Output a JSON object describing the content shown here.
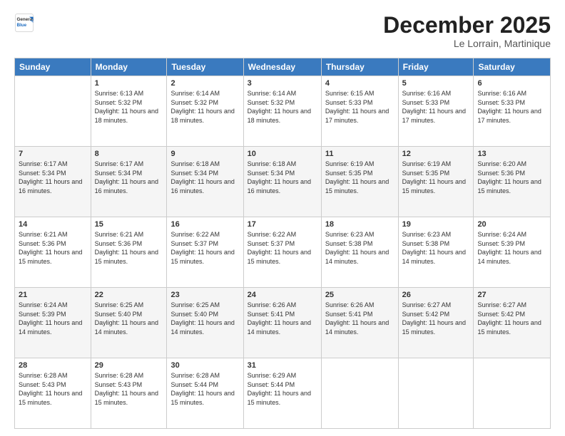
{
  "logo": {
    "general": "General",
    "blue": "Blue"
  },
  "header": {
    "month": "December 2025",
    "location": "Le Lorrain, Martinique"
  },
  "weekdays": [
    "Sunday",
    "Monday",
    "Tuesday",
    "Wednesday",
    "Thursday",
    "Friday",
    "Saturday"
  ],
  "weeks": [
    [
      {
        "day": "",
        "sunrise": "",
        "sunset": "",
        "daylight": ""
      },
      {
        "day": "1",
        "sunrise": "6:13 AM",
        "sunset": "5:32 PM",
        "daylight": "11 hours and 18 minutes."
      },
      {
        "day": "2",
        "sunrise": "6:14 AM",
        "sunset": "5:32 PM",
        "daylight": "11 hours and 18 minutes."
      },
      {
        "day": "3",
        "sunrise": "6:14 AM",
        "sunset": "5:32 PM",
        "daylight": "11 hours and 18 minutes."
      },
      {
        "day": "4",
        "sunrise": "6:15 AM",
        "sunset": "5:33 PM",
        "daylight": "11 hours and 17 minutes."
      },
      {
        "day": "5",
        "sunrise": "6:16 AM",
        "sunset": "5:33 PM",
        "daylight": "11 hours and 17 minutes."
      },
      {
        "day": "6",
        "sunrise": "6:16 AM",
        "sunset": "5:33 PM",
        "daylight": "11 hours and 17 minutes."
      }
    ],
    [
      {
        "day": "7",
        "sunrise": "6:17 AM",
        "sunset": "5:34 PM",
        "daylight": "11 hours and 16 minutes."
      },
      {
        "day": "8",
        "sunrise": "6:17 AM",
        "sunset": "5:34 PM",
        "daylight": "11 hours and 16 minutes."
      },
      {
        "day": "9",
        "sunrise": "6:18 AM",
        "sunset": "5:34 PM",
        "daylight": "11 hours and 16 minutes."
      },
      {
        "day": "10",
        "sunrise": "6:18 AM",
        "sunset": "5:34 PM",
        "daylight": "11 hours and 16 minutes."
      },
      {
        "day": "11",
        "sunrise": "6:19 AM",
        "sunset": "5:35 PM",
        "daylight": "11 hours and 15 minutes."
      },
      {
        "day": "12",
        "sunrise": "6:19 AM",
        "sunset": "5:35 PM",
        "daylight": "11 hours and 15 minutes."
      },
      {
        "day": "13",
        "sunrise": "6:20 AM",
        "sunset": "5:36 PM",
        "daylight": "11 hours and 15 minutes."
      }
    ],
    [
      {
        "day": "14",
        "sunrise": "6:21 AM",
        "sunset": "5:36 PM",
        "daylight": "11 hours and 15 minutes."
      },
      {
        "day": "15",
        "sunrise": "6:21 AM",
        "sunset": "5:36 PM",
        "daylight": "11 hours and 15 minutes."
      },
      {
        "day": "16",
        "sunrise": "6:22 AM",
        "sunset": "5:37 PM",
        "daylight": "11 hours and 15 minutes."
      },
      {
        "day": "17",
        "sunrise": "6:22 AM",
        "sunset": "5:37 PM",
        "daylight": "11 hours and 15 minutes."
      },
      {
        "day": "18",
        "sunrise": "6:23 AM",
        "sunset": "5:38 PM",
        "daylight": "11 hours and 14 minutes."
      },
      {
        "day": "19",
        "sunrise": "6:23 AM",
        "sunset": "5:38 PM",
        "daylight": "11 hours and 14 minutes."
      },
      {
        "day": "20",
        "sunrise": "6:24 AM",
        "sunset": "5:39 PM",
        "daylight": "11 hours and 14 minutes."
      }
    ],
    [
      {
        "day": "21",
        "sunrise": "6:24 AM",
        "sunset": "5:39 PM",
        "daylight": "11 hours and 14 minutes."
      },
      {
        "day": "22",
        "sunrise": "6:25 AM",
        "sunset": "5:40 PM",
        "daylight": "11 hours and 14 minutes."
      },
      {
        "day": "23",
        "sunrise": "6:25 AM",
        "sunset": "5:40 PM",
        "daylight": "11 hours and 14 minutes."
      },
      {
        "day": "24",
        "sunrise": "6:26 AM",
        "sunset": "5:41 PM",
        "daylight": "11 hours and 14 minutes."
      },
      {
        "day": "25",
        "sunrise": "6:26 AM",
        "sunset": "5:41 PM",
        "daylight": "11 hours and 14 minutes."
      },
      {
        "day": "26",
        "sunrise": "6:27 AM",
        "sunset": "5:42 PM",
        "daylight": "11 hours and 15 minutes."
      },
      {
        "day": "27",
        "sunrise": "6:27 AM",
        "sunset": "5:42 PM",
        "daylight": "11 hours and 15 minutes."
      }
    ],
    [
      {
        "day": "28",
        "sunrise": "6:28 AM",
        "sunset": "5:43 PM",
        "daylight": "11 hours and 15 minutes."
      },
      {
        "day": "29",
        "sunrise": "6:28 AM",
        "sunset": "5:43 PM",
        "daylight": "11 hours and 15 minutes."
      },
      {
        "day": "30",
        "sunrise": "6:28 AM",
        "sunset": "5:44 PM",
        "daylight": "11 hours and 15 minutes."
      },
      {
        "day": "31",
        "sunrise": "6:29 AM",
        "sunset": "5:44 PM",
        "daylight": "11 hours and 15 minutes."
      },
      {
        "day": "",
        "sunrise": "",
        "sunset": "",
        "daylight": ""
      },
      {
        "day": "",
        "sunrise": "",
        "sunset": "",
        "daylight": ""
      },
      {
        "day": "",
        "sunrise": "",
        "sunset": "",
        "daylight": ""
      }
    ]
  ],
  "labels": {
    "sunrise": "Sunrise:",
    "sunset": "Sunset:",
    "daylight": "Daylight:"
  }
}
